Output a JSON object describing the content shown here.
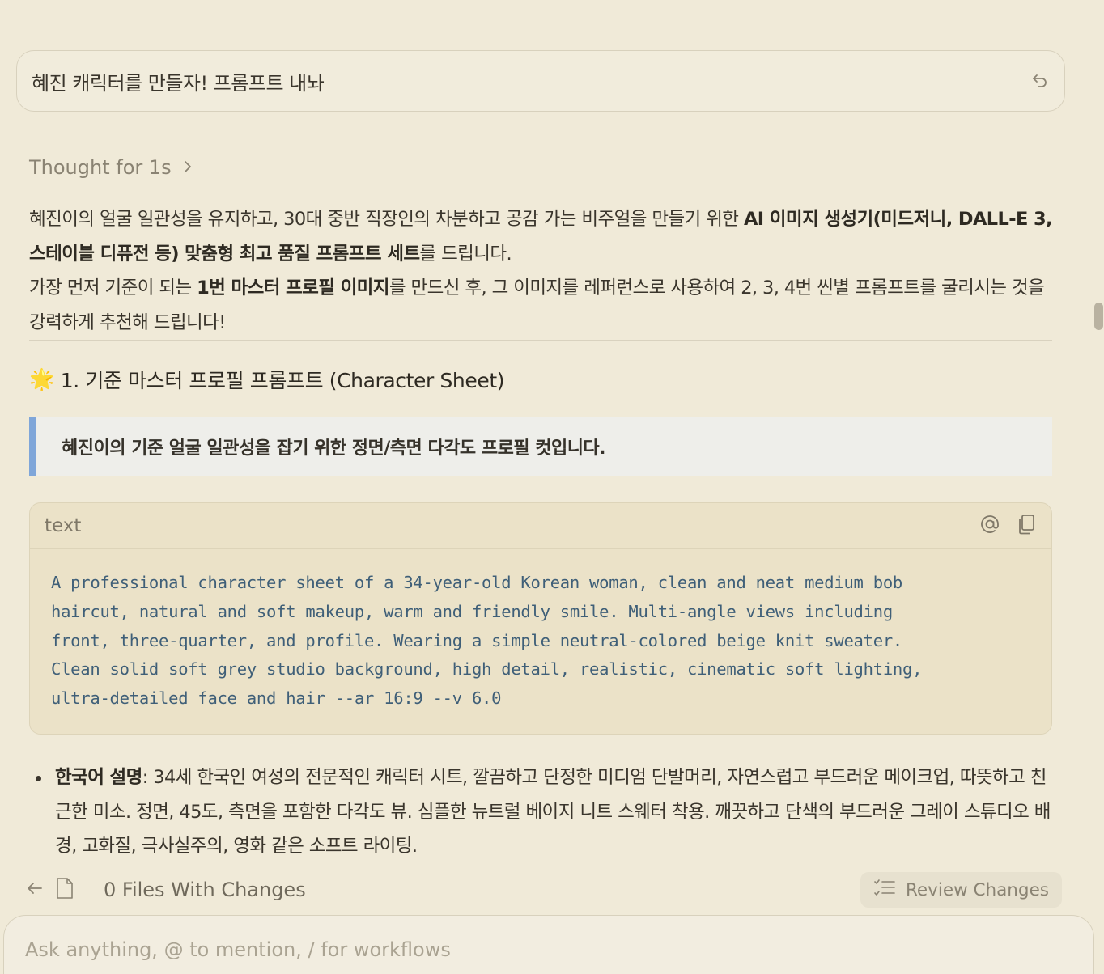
{
  "user_message": {
    "text": "혜진 캐릭터를 만들자! 프롬프트 내놔"
  },
  "thought": {
    "label": "Thought for 1s"
  },
  "intro": {
    "p1_a": "혜진이의 얼굴 일관성을 유지하고, 30대 중반 직장인의 차분하고 공감 가는 비주얼을 만들기 위한 ",
    "p1_b": "AI 이미지 생성기(미드저니, DALL-E 3, 스테이블 디퓨전 등) 맞춤형 최고 품질 프롬프트 세트",
    "p1_c": "를 드립니다.",
    "p2_a": "가장 먼저 기준이 되는 ",
    "p2_b": "1번 마스터 프로필 이미지",
    "p2_c": "를 만드신 후, 그 이미지를 레퍼런스로 사용하여 2, 3, 4번 씬별 프롬프트를 굴리시는 것을 강력하게 추천해 드립니다!"
  },
  "section1": {
    "emoji": "🌟",
    "title": "1. 기준 마스터 프로필 프롬프트 (Character Sheet)"
  },
  "quote": {
    "text": "혜진이의 기준 얼굴 일관성을 잡기 위한 정면/측면 다각도 프로필 컷입니다."
  },
  "code_block": {
    "language": "text",
    "lines": [
      "A professional character sheet of a 34-year-old Korean woman, clean and neat medium bob",
      "haircut, natural and soft makeup, warm and friendly smile. Multi-angle views including",
      "front, three-quarter, and profile. Wearing a simple neutral-colored beige knit sweater.",
      "Clean solid soft grey studio background, high detail, realistic, cinematic soft lighting,",
      "ultra-detailed face and hair --ar 16:9 --v 6.0"
    ]
  },
  "bullet": {
    "label": "한국어 설명",
    "text": ": 34세 한국인 여성의 전문적인 캐릭터 시트, 깔끔하고 단정한 미디엄 단발머리, 자연스럽고 부드러운 메이크업, 따뜻하고 친근한 미소. 정면, 45도, 측면을 포함한 다각도 뷰. 심플한 뉴트럴 베이지 니트 스웨터 착용. 깨끗하고 단색의 부드러운 그레이 스튜디오 배경, 고화질, 극사실주의, 영화 같은 소프트 라이팅."
  },
  "changes": {
    "label": "0 Files With Changes",
    "review_label": "Review Changes"
  },
  "composer": {
    "placeholder": "Ask anything, @ to mention, / for workflows"
  },
  "colors": {
    "background": "#f0ead8",
    "code_text": "#3f5f78",
    "quote_border": "#7fa6d9"
  }
}
